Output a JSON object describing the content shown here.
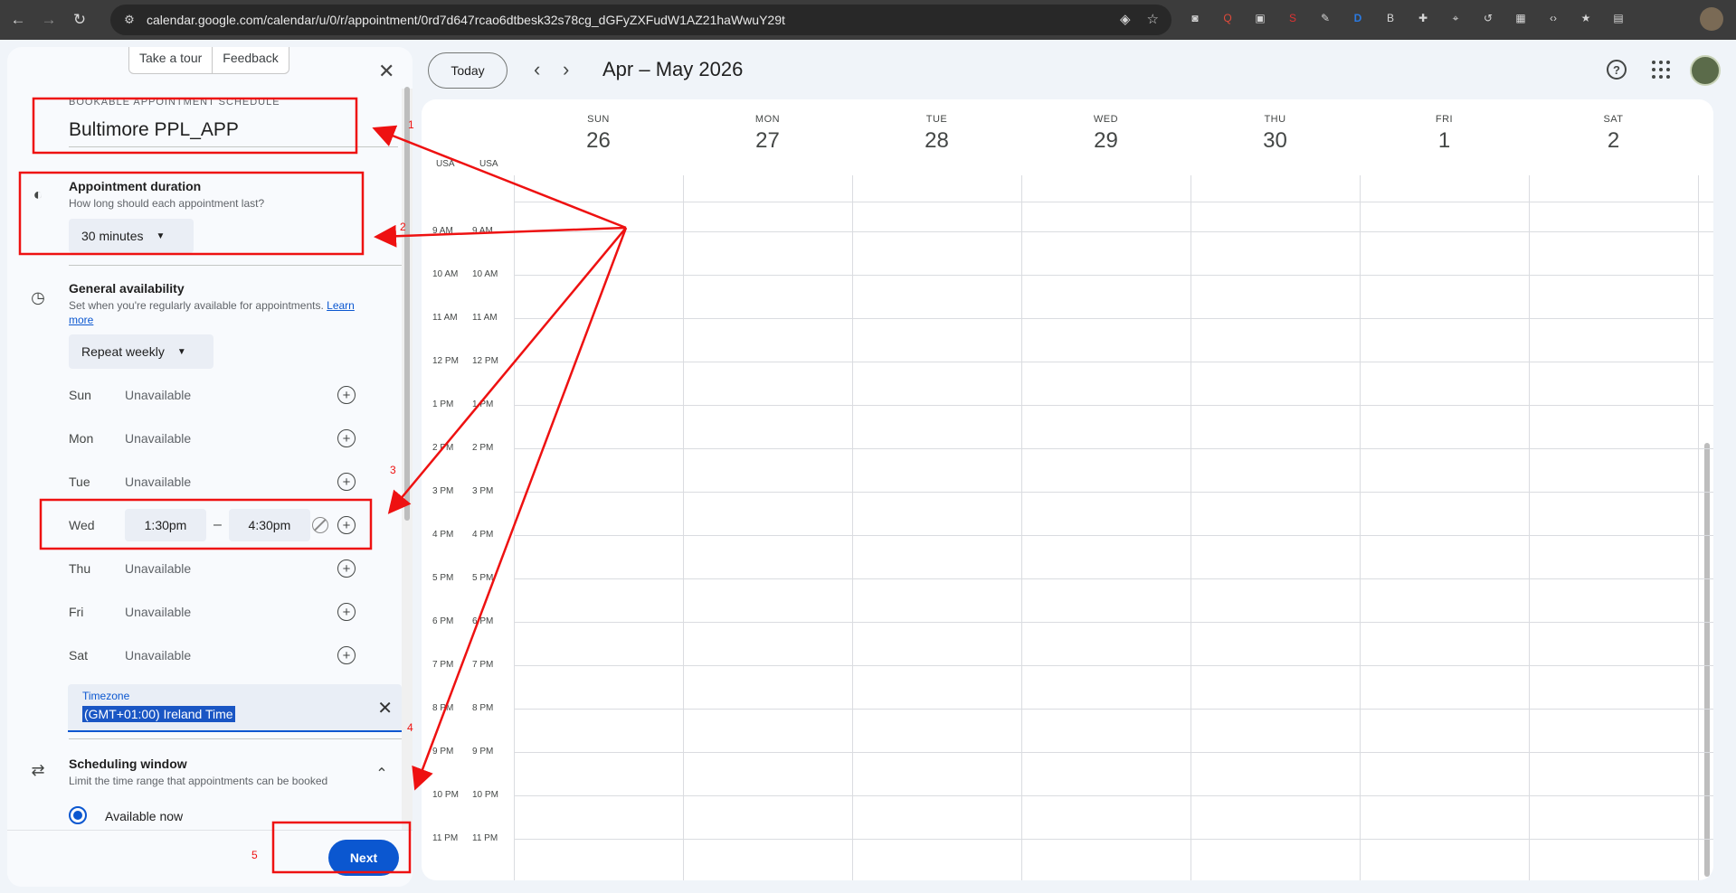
{
  "browser": {
    "url": "calendar.google.com/calendar/u/0/r/appointment/0rd7d647rcao6dtbesk32s78cg_dGFyZXFudW1AZ21haWwuY29t",
    "extensions": [
      "camera-icon",
      "red-q-icon",
      "gray-box-icon",
      "red-s-icon",
      "feather-icon",
      "blue-d-icon",
      "bz-icon",
      "puzzle-icon",
      "pin-icon",
      "history-icon",
      "layout-icon",
      "code-icon",
      "star-list-icon",
      "trash-icon"
    ]
  },
  "panel": {
    "take_tour": "Take a tour",
    "feedback": "Feedback",
    "caption": "BOOKABLE APPOINTMENT SCHEDULE",
    "title": "Bultimore PPL_APP",
    "duration": {
      "title": "Appointment duration",
      "subtitle": "How long should each appointment last?",
      "value": "30 minutes"
    },
    "availability": {
      "title": "General availability",
      "subtitle": "Set when you're regularly available for appointments.",
      "learn": "Learn",
      "more": "more",
      "repeat": "Repeat weekly",
      "days": [
        {
          "day": "Sun",
          "value": "Unavailable"
        },
        {
          "day": "Mon",
          "value": "Unavailable"
        },
        {
          "day": "Tue",
          "value": "Unavailable"
        },
        {
          "day": "Wed",
          "start": "1:30pm",
          "end": "4:30pm",
          "dash": "–"
        },
        {
          "day": "Thu",
          "value": "Unavailable"
        },
        {
          "day": "Fri",
          "value": "Unavailable"
        },
        {
          "day": "Sat",
          "value": "Unavailable"
        }
      ]
    },
    "timezone": {
      "label": "Timezone",
      "value": "(GMT+01:00) Ireland Time"
    },
    "window": {
      "title": "Scheduling window",
      "subtitle": "Limit the time range that appointments can be booked",
      "option": "Available now"
    },
    "next": "Next"
  },
  "calendar": {
    "today": "Today",
    "range": "Apr – May 2026",
    "days": [
      {
        "dow": "SUN",
        "num": "26"
      },
      {
        "dow": "MON",
        "num": "27"
      },
      {
        "dow": "TUE",
        "num": "28"
      },
      {
        "dow": "WED",
        "num": "29"
      },
      {
        "dow": "THU",
        "num": "30"
      },
      {
        "dow": "FRI",
        "num": "1"
      },
      {
        "dow": "SAT",
        "num": "2"
      }
    ],
    "tz_labels": [
      "USA",
      "USA"
    ],
    "hours": [
      "9 AM",
      "10 AM",
      "11 AM",
      "12 PM",
      "1 PM",
      "2 PM",
      "3 PM",
      "4 PM",
      "5 PM",
      "6 PM",
      "7 PM",
      "8 PM",
      "9 PM",
      "10 PM",
      "11 PM"
    ]
  },
  "annotations": {
    "color": "#e11",
    "labels": [
      "1",
      "2",
      "3",
      "4",
      "5"
    ]
  }
}
